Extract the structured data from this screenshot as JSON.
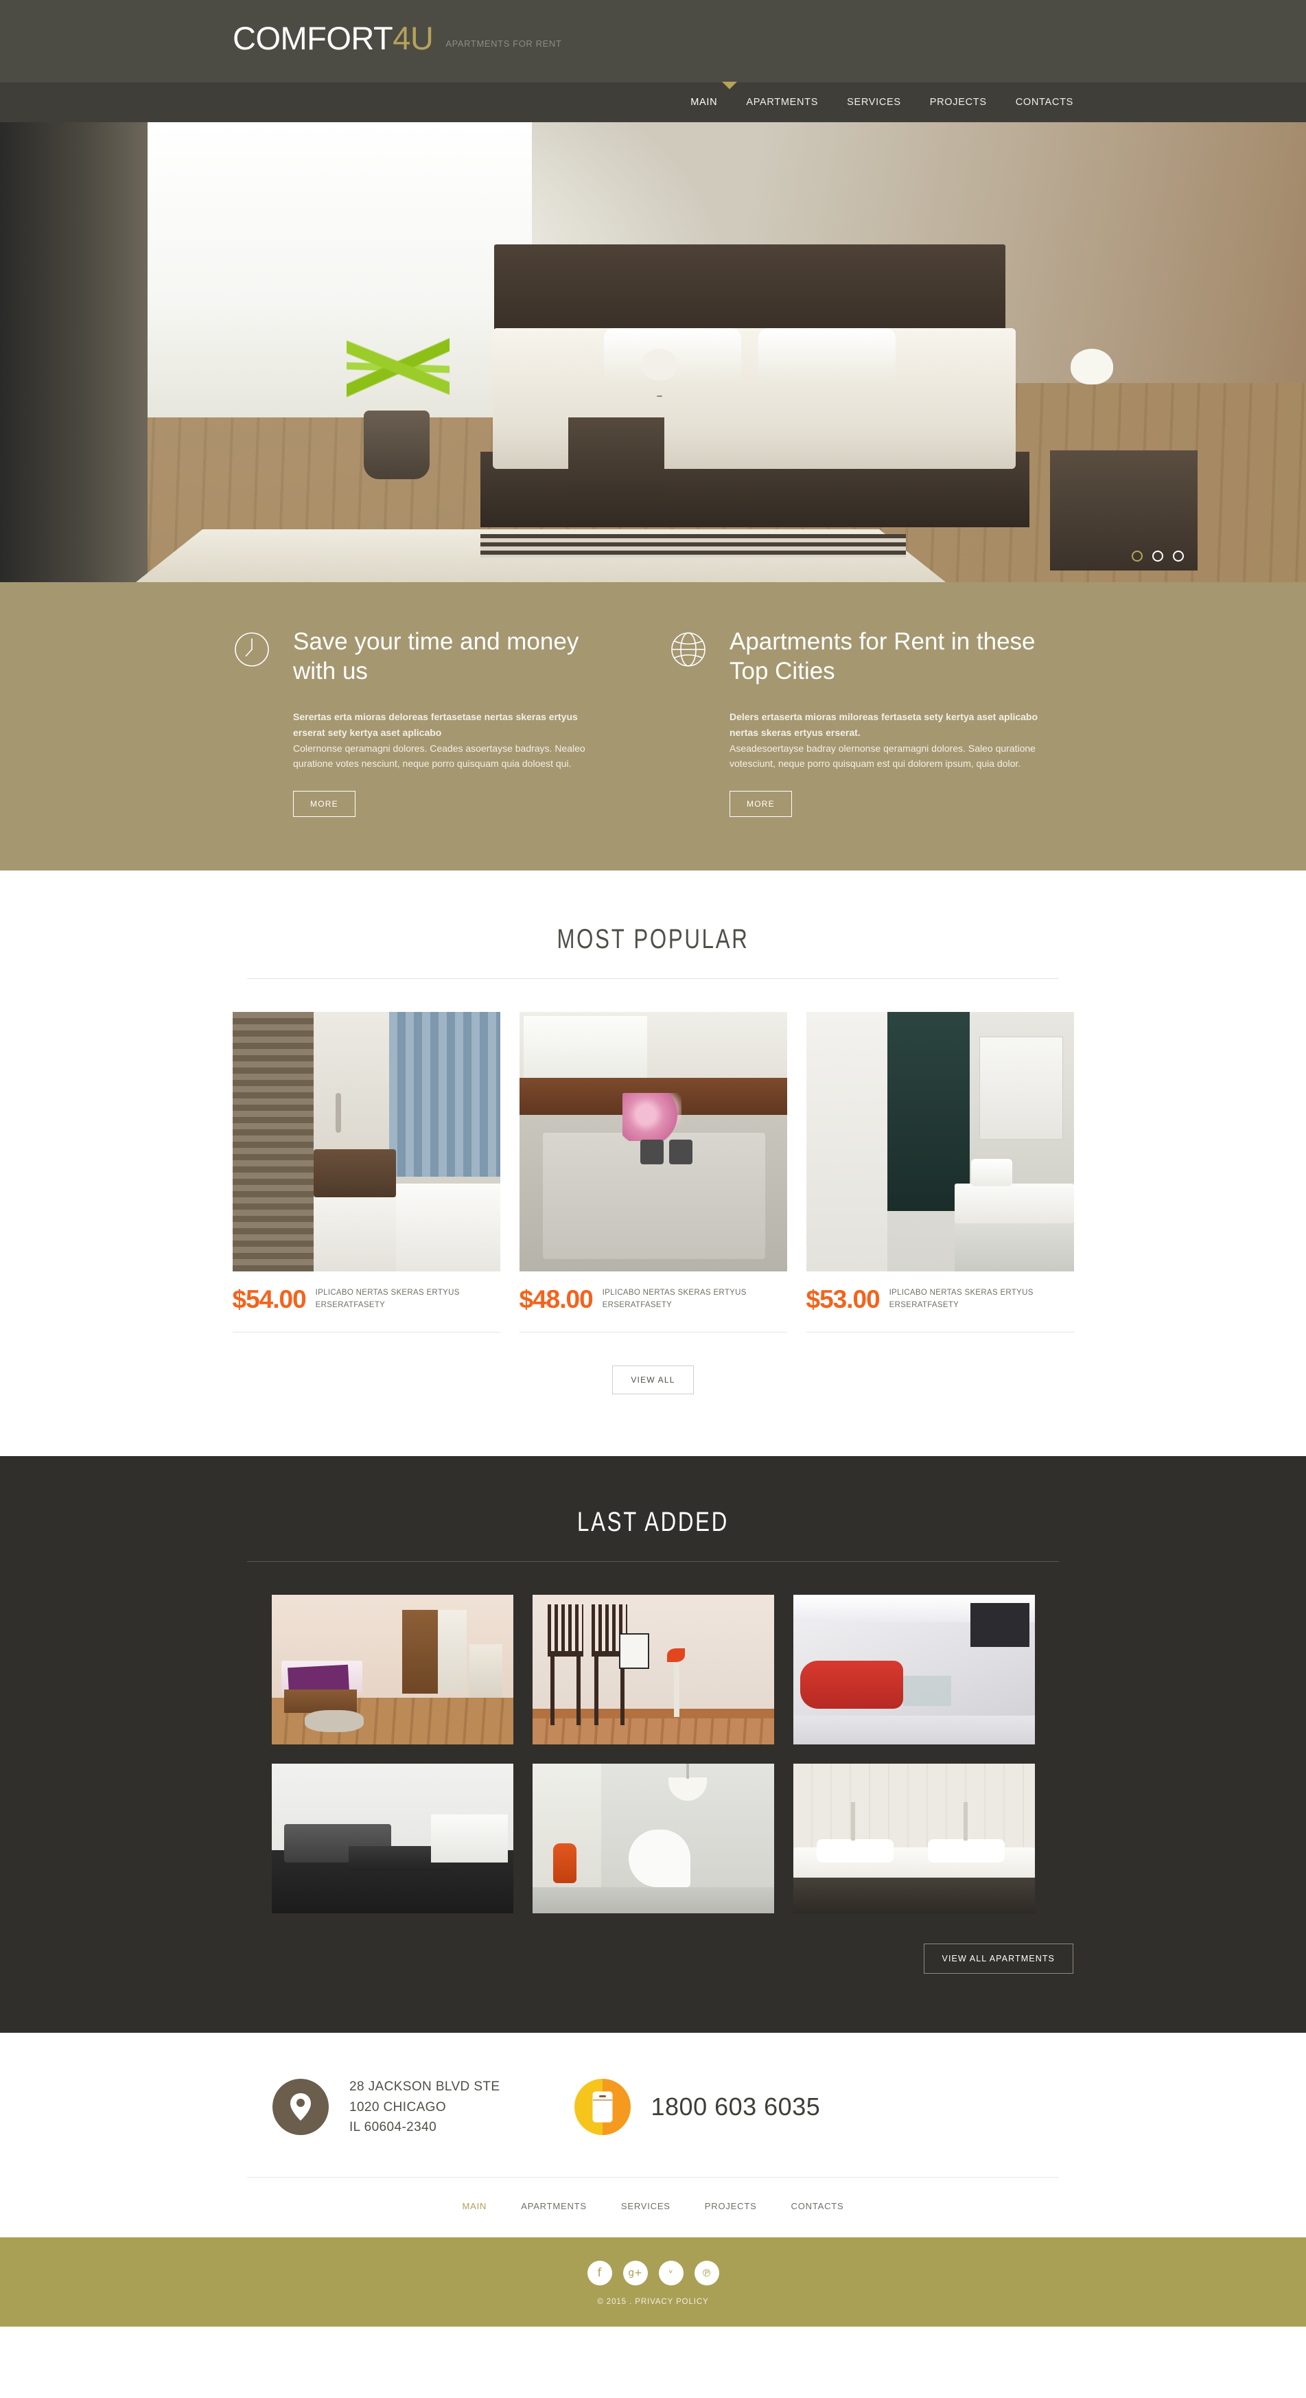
{
  "header": {
    "logo_main": "COMFORT",
    "logo_accent": "4U",
    "tagline": "APARTMENTS FOR RENT",
    "nav": [
      {
        "label": "MAIN",
        "active": true
      },
      {
        "label": "APARTMENTS",
        "active": false
      },
      {
        "label": "SERVICES",
        "active": false
      },
      {
        "label": "PROJECTS",
        "active": false
      },
      {
        "label": "CONTACTS",
        "active": false
      }
    ]
  },
  "hero": {
    "slides": 3,
    "active_slide": 1
  },
  "features": [
    {
      "icon": "clock-icon",
      "title": "Save your time and money with us",
      "lead": "Serertas erta mioras deloreas fertasetase nertas skeras ertyus erserat sety kertya aset aplicabo",
      "body": "Colernonse qeramagni dolores. Ceades asoertayse badrays. Nealeo quratione votes nesciunt, neque porro quisquam quia doloest qui.",
      "button": "MORE"
    },
    {
      "icon": "globe-icon",
      "title": "Apartments for Rent in these Top Cities",
      "lead": "Delers ertaserta mioras miloreas fertaseta sety kertya aset aplicabo nertas skeras ertyus erserat.",
      "body": "Aseadesoertayse badray olernonse qeramagni dolores. Saleo quratione votesciunt, neque porro quisquam est qui dolorem ipsum, quia dolor.",
      "button": "MORE"
    }
  ],
  "most_popular": {
    "title": "MOST POPULAR",
    "cards": [
      {
        "price": "$54.00",
        "caption": "IPLICABO NERTAS SKERAS ERTYUS ERSERATFASETY"
      },
      {
        "price": "$48.00",
        "caption": "IPLICABO NERTAS SKERAS ERTYUS ERSERATFASETY"
      },
      {
        "price": "$53.00",
        "caption": "IPLICABO NERTAS SKERAS ERTYUS ERSERATFASETY"
      }
    ],
    "view_all": "VIEW ALL"
  },
  "last_added": {
    "title": "LAST ADDED",
    "items": 6,
    "view_all": "VIEW ALL APARTMENTS"
  },
  "contact": {
    "address_line1": "28 JACKSON BLVD STE",
    "address_line2": "1020 CHICAGO",
    "address_line3": "IL 60604-2340",
    "phone": "1800 603 6035",
    "map_icon": "location-pin-icon",
    "phone_icon": "mobile-phone-icon"
  },
  "footer_nav": [
    {
      "label": "MAIN",
      "active": true
    },
    {
      "label": "APARTMENTS",
      "active": false
    },
    {
      "label": "SERVICES",
      "active": false
    },
    {
      "label": "PROJECTS",
      "active": false
    },
    {
      "label": "CONTACTS",
      "active": false
    }
  ],
  "bottom": {
    "socials": [
      {
        "name": "facebook-icon",
        "glyph": "f"
      },
      {
        "name": "google-plus-icon",
        "glyph": "g+"
      },
      {
        "name": "twitter-icon",
        "glyph": "ᵛ"
      },
      {
        "name": "pinterest-icon",
        "glyph": "℗"
      }
    ],
    "copyright": "© 2015 . PRIVACY POLICY"
  },
  "colors": {
    "topbar": "#4c4c44",
    "navbar": "#403e38",
    "gold": "#a59770",
    "accent_gold": "#b5a35a",
    "dark": "#312f2b",
    "price_orange": "#f4631c",
    "bottom_olive": "#a9a055"
  }
}
